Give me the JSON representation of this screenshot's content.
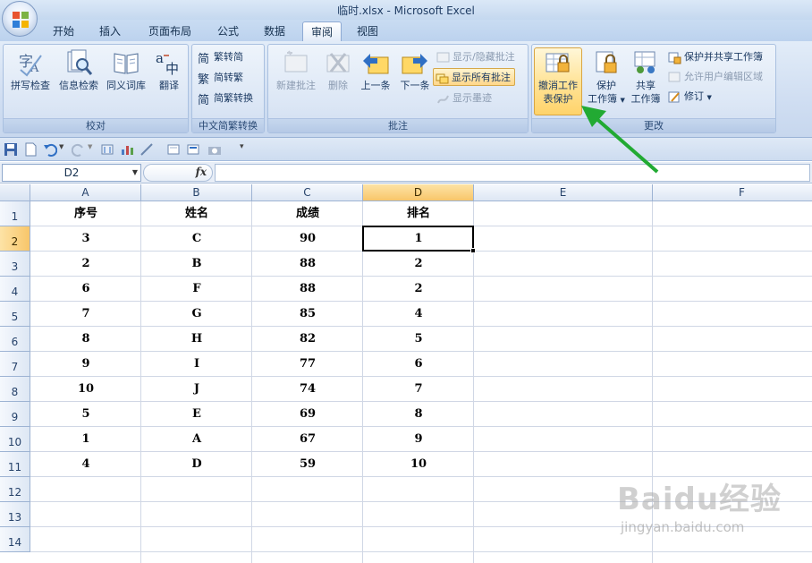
{
  "window": {
    "title": "临时.xlsx - Microsoft Excel"
  },
  "tabs": [
    "开始",
    "插入",
    "页面布局",
    "公式",
    "数据",
    "审阅",
    "视图"
  ],
  "active_tab": "审阅",
  "ribbon": {
    "proofing": {
      "label": "校对",
      "spelling": "拼写检查",
      "research": "信息检索",
      "thesaurus": "同义词库",
      "translate": "翻译"
    },
    "chinese": {
      "label": "中文简繁转换",
      "to_simplified": "繁转简",
      "to_traditional": "简转繁",
      "convert": "简繁转换"
    },
    "comments": {
      "label": "批注",
      "new": "新建批注",
      "delete": "删除",
      "previous": "上一条",
      "next": "下一条",
      "show_hide": "显示/隐藏批注",
      "show_all": "显示所有批注",
      "show_ink": "显示墨迹"
    },
    "changes": {
      "label": "更改",
      "unprotect_line1": "撤消工作",
      "unprotect_line2": "表保护",
      "protect_wb_line1": "保护",
      "protect_wb_line2": "工作簿",
      "share_line1": "共享",
      "share_line2": "工作簿",
      "protect_share": "保护并共享工作簿",
      "allow_edit": "允许用户编辑区域",
      "track": "修订"
    }
  },
  "formula_bar": {
    "name_box": "D2",
    "fx": "fx",
    "value": ""
  },
  "columns": [
    "A",
    "B",
    "C",
    "D",
    "E",
    "F"
  ],
  "selected_column": "D",
  "selected_row": 2,
  "rows": [
    {
      "n": "1",
      "cells": [
        "序号",
        "姓名",
        "成绩",
        "排名"
      ]
    },
    {
      "n": "2",
      "cells": [
        "3",
        "C",
        "90",
        "1"
      ]
    },
    {
      "n": "3",
      "cells": [
        "2",
        "B",
        "88",
        "2"
      ]
    },
    {
      "n": "4",
      "cells": [
        "6",
        "F",
        "88",
        "2"
      ]
    },
    {
      "n": "5",
      "cells": [
        "7",
        "G",
        "85",
        "4"
      ]
    },
    {
      "n": "6",
      "cells": [
        "8",
        "H",
        "82",
        "5"
      ]
    },
    {
      "n": "7",
      "cells": [
        "9",
        "I",
        "77",
        "6"
      ]
    },
    {
      "n": "8",
      "cells": [
        "10",
        "J",
        "74",
        "7"
      ]
    },
    {
      "n": "9",
      "cells": [
        "5",
        "E",
        "69",
        "8"
      ]
    },
    {
      "n": "10",
      "cells": [
        "1",
        "A",
        "67",
        "9"
      ]
    },
    {
      "n": "11",
      "cells": [
        "4",
        "D",
        "59",
        "10"
      ]
    },
    {
      "n": "12",
      "cells": [
        "",
        "",
        "",
        ""
      ]
    },
    {
      "n": "13",
      "cells": [
        "",
        "",
        "",
        ""
      ]
    },
    {
      "n": "14",
      "cells": [
        "",
        "",
        "",
        ""
      ]
    }
  ],
  "watermark": {
    "brand": "Baidu经验",
    "site": "jingyan.baidu.com"
  },
  "colors": {
    "accent_green": "#22aa33",
    "selection_orange": "#f8c66a",
    "ribbon_blue": "#d0def2"
  }
}
